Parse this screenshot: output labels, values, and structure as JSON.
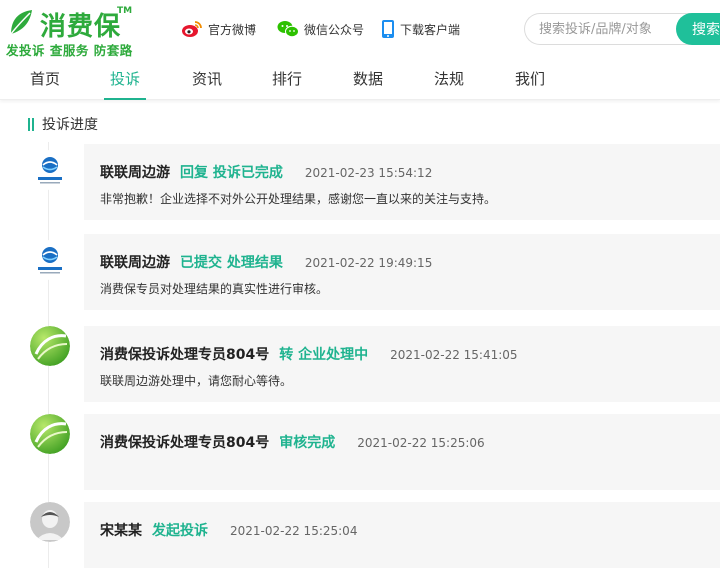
{
  "header": {
    "logo_text": "消费保",
    "logo_tm": "TM",
    "slogan": "发投诉 查服务 防套路",
    "links": [
      {
        "label": "官方微博",
        "icon": "weibo-icon"
      },
      {
        "label": "微信公众号",
        "icon": "wechat-icon"
      },
      {
        "label": "下载客户端",
        "icon": "phone-icon"
      }
    ],
    "search": {
      "placeholder": "搜索投诉/品牌/对象",
      "button_label": "搜索"
    }
  },
  "nav": {
    "items": [
      "首页",
      "投诉",
      "资讯",
      "排行",
      "数据",
      "法规",
      "我们"
    ],
    "active": "投诉"
  },
  "section": {
    "title": "投诉进度"
  },
  "timeline": [
    {
      "name": "联联周边游",
      "action": "回复 投诉已完成",
      "time": "2021-02-23 15:54:12",
      "content": "非常抱歉！企业选择不对外公开处理结果，感谢您一直以来的关注与支持。",
      "avatar": "company-logo"
    },
    {
      "name": "联联周边游",
      "action": "已提交 处理结果",
      "time": "2021-02-22 19:49:15",
      "content": "消费保专员对处理结果的真实性进行审核。",
      "avatar": "company-logo"
    },
    {
      "name": "消费保投诉处理专员804号",
      "action": "转 企业处理中",
      "time": "2021-02-22 15:41:05",
      "content": "联联周边游处理中，请您耐心等待。",
      "avatar": "xfb-logo"
    },
    {
      "name": "消费保投诉处理专员804号",
      "action": "审核完成",
      "time": "2021-02-22 15:25:06",
      "content": "",
      "avatar": "xfb-logo"
    },
    {
      "name": "宋某某",
      "action": "发起投诉",
      "time": "2021-02-22 15:25:04",
      "content": "",
      "avatar": "user-avatar"
    }
  ],
  "colors": {
    "brand": "#2eaa3c",
    "accent": "#1fb38f",
    "search_button": "#1fc09a",
    "card_bg": "#f6f6f6"
  }
}
